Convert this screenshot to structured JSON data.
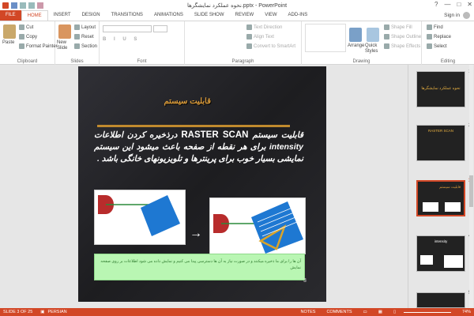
{
  "window": {
    "title": "نحوه عملکرد نمایشگرها.pptx - PowerPoint",
    "controls": [
      "?",
      "—",
      "□",
      "✕"
    ]
  },
  "tabs": [
    {
      "label": "FILE"
    },
    {
      "label": "HOME"
    },
    {
      "label": "INSERT"
    },
    {
      "label": "DESIGN"
    },
    {
      "label": "TRANSITIONS"
    },
    {
      "label": "ANIMATIONS"
    },
    {
      "label": "SLIDE SHOW"
    },
    {
      "label": "REVIEW"
    },
    {
      "label": "VIEW"
    },
    {
      "label": "ADD-INS"
    }
  ],
  "account": {
    "sign_in": "Sign in"
  },
  "ribbon": {
    "clipboard": {
      "label": "Clipboard",
      "paste": "Paste",
      "cut": "Cut",
      "copy": "Copy",
      "format_painter": "Format Painter"
    },
    "slides": {
      "label": "Slides",
      "new_slide": "New Slide",
      "layout": "Layout",
      "reset": "Reset",
      "section": "Section"
    },
    "font": {
      "label": "Font"
    },
    "paragraph": {
      "label": "Paragraph",
      "text_direction": "Text Direction",
      "align_text": "Align Text",
      "convert": "Convert to SmartArt"
    },
    "drawing": {
      "label": "Drawing",
      "arrange": "Arrange",
      "quick_styles": "Quick Styles",
      "shape_fill": "Shape Fill",
      "shape_outline": "Shape Outline",
      "shape_effects": "Shape Effects"
    },
    "editing": {
      "label": "Editing",
      "find": "Find",
      "replace": "Replace",
      "select": "Select"
    }
  },
  "slide": {
    "title": "قابلیت سیستم",
    "body_pre": "قابلیت سیستم ",
    "body_highlight1": "RASTER SCAN",
    "body_mid": " درذخیره کردن اطلاعات ",
    "body_highlight2": "intensity",
    "body_post": " برای هر نقطه از صفحه باعث میشود این سیستم نمایشی بسیار خوب برای پرینترها و تلویزیونهای خانگی باشد .",
    "arrow": "→",
    "caption": "آن ها را برای ما ذخیره میکنند و در صورت نیاز به آن ها دسترسی پیدا می کنیم  و نمایش داده می شود  اطلاعات  بر روی صفحه نمایش",
    "number": "3"
  },
  "thumbnails": [
    {
      "num": "1",
      "text": "نحوه عملکرد نمایشگرها"
    },
    {
      "num": "2",
      "text": "RASTER SCAN"
    },
    {
      "num": "3",
      "text": "قابلیت سیستم"
    },
    {
      "num": "4",
      "text": "intensity"
    },
    {
      "num": "5",
      "text": ""
    }
  ],
  "status": {
    "slide_info": "SLIDE 3 OF 25",
    "language": "PERSIAN",
    "notes": "NOTES",
    "comments": "COMMENTS",
    "zoom": "74%"
  },
  "colors": {
    "accent": "#d24726",
    "slide_title": "#d89a3a",
    "caption_bg": "#b9f6b3"
  }
}
